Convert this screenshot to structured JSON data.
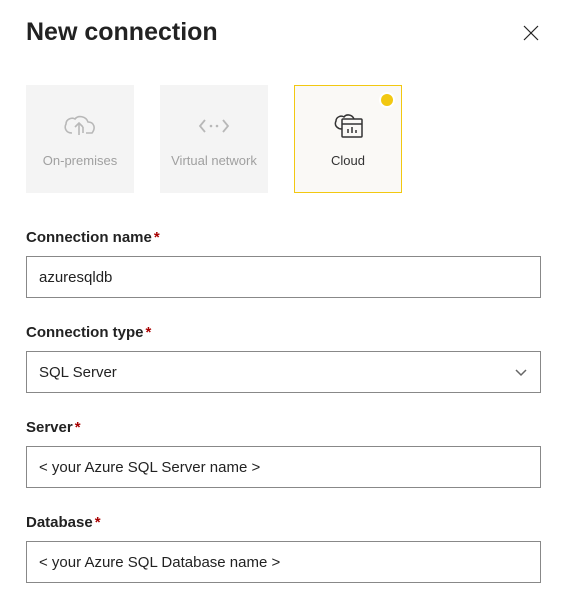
{
  "header": {
    "title": "New connection"
  },
  "tiles": {
    "on_premises": "On-premises",
    "virtual_network": "Virtual network",
    "cloud": "Cloud"
  },
  "fields": {
    "connection_name": {
      "label": "Connection name",
      "value": "azuresqldb"
    },
    "connection_type": {
      "label": "Connection type",
      "value": "SQL Server"
    },
    "server": {
      "label": "Server",
      "value": "< your Azure SQL Server name >"
    },
    "database": {
      "label": "Database",
      "value": "< your Azure SQL Database name >"
    }
  },
  "required_marker": "*"
}
